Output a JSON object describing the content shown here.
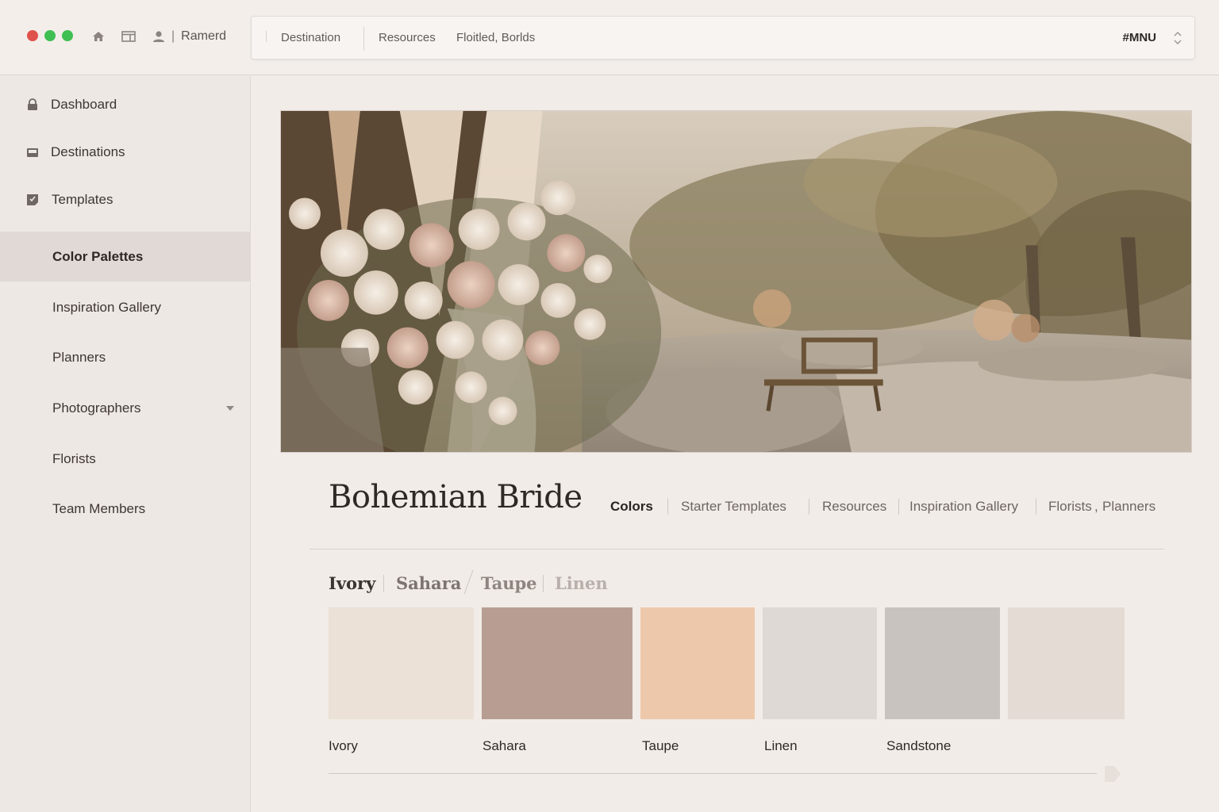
{
  "window": {
    "user_name": "Ramerd",
    "user_separator": "|"
  },
  "topnav": {
    "items": [
      "Destination",
      "Resources",
      "Floitled, Borlds"
    ],
    "menu_label": "#MNU"
  },
  "sidebar": {
    "items": [
      {
        "label": "Dashboard",
        "icon": "lock-icon"
      },
      {
        "label": "Destinations",
        "icon": "inbox-icon"
      },
      {
        "label": "Templates",
        "icon": "template-icon"
      },
      {
        "label": "Color Palettes",
        "active": true
      },
      {
        "label": "Inspiration Gallery"
      },
      {
        "label": "Planners"
      },
      {
        "label": "Photographers",
        "has_dropdown": true
      },
      {
        "label": "Florists"
      },
      {
        "label": "Team Members"
      }
    ]
  },
  "page": {
    "title": "Bohemian Bride",
    "subnav": [
      "Colors",
      "Starter Templates",
      "Resources",
      "Inspiration Gallery",
      "Florists",
      "Planners"
    ],
    "subnav_separator_between_florists_planners": ","
  },
  "palette": {
    "tabs": [
      "Ivory",
      "Sahara",
      "Taupe",
      "Linen"
    ],
    "swatches": [
      {
        "label": "Ivory",
        "color": "#ebe1d6"
      },
      {
        "label": "Sahara",
        "color": "#b89e92"
      },
      {
        "label": "Taupe",
        "color": "#eec8ab"
      },
      {
        "label": "Linen",
        "color": "#dfd9d5"
      },
      {
        "label": "Sandstone",
        "color": "#c9c3c0"
      },
      {
        "label": "",
        "color": "#e4dbd5"
      }
    ]
  },
  "colors": {
    "background": "#f1ece8",
    "sidebar_active": "#e0d9d5",
    "traffic_red": "#e0524c",
    "traffic_green": "#3fbf52"
  }
}
